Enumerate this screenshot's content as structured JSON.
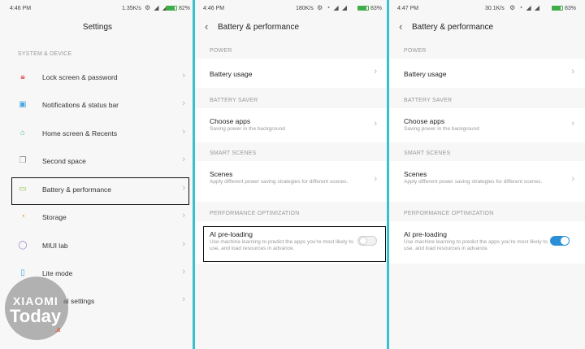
{
  "accent_color": "#36c0d2",
  "toggle_on_color": "#2b8fd8",
  "panel1": {
    "status": {
      "time": "4:46 PM",
      "net": "1.35K/s",
      "battery": "82%",
      "battery_level": 0.82
    },
    "title": "Settings",
    "section": "SYSTEM & DEVICE",
    "items": [
      {
        "icon": "lock-icon",
        "label": "Lock screen & password"
      },
      {
        "icon": "notification-icon",
        "label": "Notifications & status bar"
      },
      {
        "icon": "home-icon",
        "label": "Home screen & Recents"
      },
      {
        "icon": "second-space-icon",
        "label": "Second space"
      },
      {
        "icon": "battery-icon",
        "label": "Battery & performance"
      },
      {
        "icon": "storage-icon",
        "label": "Storage"
      },
      {
        "icon": "lab-icon",
        "label": "MIUI lab"
      },
      {
        "icon": "lite-mode-icon",
        "label": "Lite mode"
      },
      {
        "icon": "settings-icon",
        "label": "al settings"
      }
    ]
  },
  "panel2": {
    "status": {
      "time": "4:46 PM",
      "net": "180K/s",
      "battery": "83%",
      "battery_level": 0.83
    },
    "title": "Battery & performance",
    "power_label": "POWER",
    "battery_usage": "Battery usage",
    "saver_label": "BATTERY SAVER",
    "choose_apps": "Choose apps",
    "choose_apps_sub": "Saving power in the background",
    "smart_label": "SMART SCENES",
    "scenes": "Scenes",
    "scenes_sub": "Apply different power saving strategies for different scenes.",
    "perf_label": "PERFORMANCE OPTIMIZATION",
    "ai": "AI pre-loading",
    "ai_sub": "Use machine learning to predict the apps you're most likely to use, and load resources in advance.",
    "ai_enabled": false
  },
  "panel3": {
    "status": {
      "time": "4:47 PM",
      "net": "30.1K/s",
      "battery": "83%",
      "battery_level": 0.83
    },
    "title": "Battery & performance",
    "power_label": "POWER",
    "battery_usage": "Battery usage",
    "saver_label": "BATTERY SAVER",
    "choose_apps": "Choose apps",
    "choose_apps_sub": "Saving power in the background",
    "smart_label": "SMART SCENES",
    "scenes": "Scenes",
    "scenes_sub": "Apply different power saving strategies for different scenes.",
    "perf_label": "PERFORMANCE OPTIMIZATION",
    "ai": "AI pre-loading",
    "ai_sub": "Use machine learning to predict the apps you're most likely to use, and load resources in advance.",
    "ai_enabled": true
  },
  "watermark": {
    "top": "XIAOMI",
    "main": "Today",
    "ext": ".it"
  }
}
